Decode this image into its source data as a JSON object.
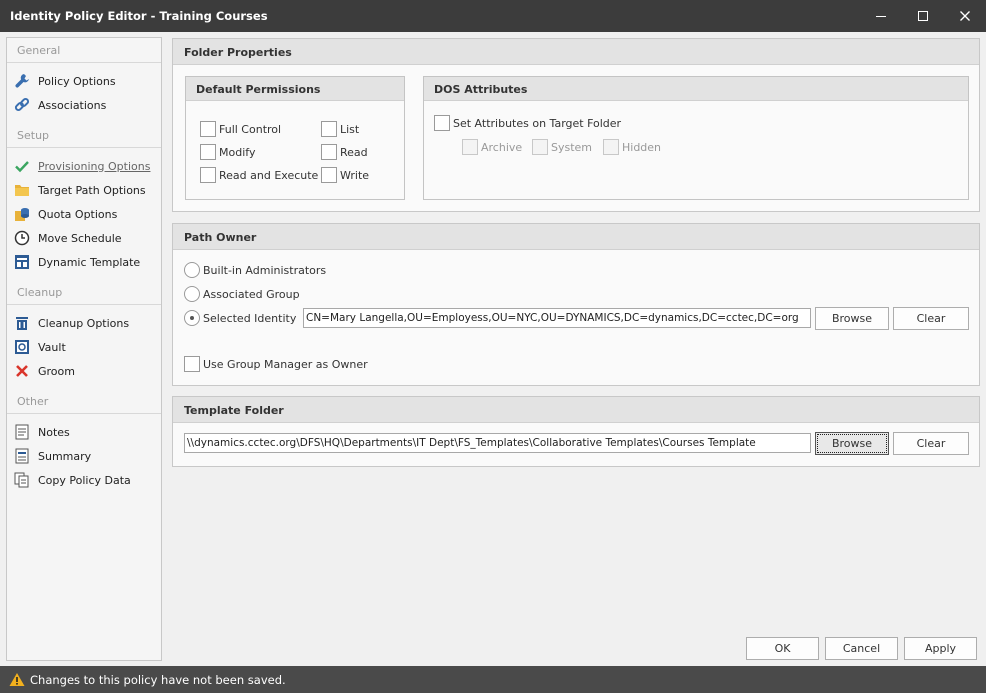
{
  "window": {
    "title": "Identity Policy Editor - Training Courses"
  },
  "sidebar": {
    "sections": [
      {
        "label": "General",
        "items": [
          {
            "label": "Policy Options",
            "icon": "wrench-icon"
          },
          {
            "label": "Associations",
            "icon": "link-icon"
          }
        ]
      },
      {
        "label": "Setup",
        "items": [
          {
            "label": "Provisioning Options",
            "icon": "checkmark-icon"
          },
          {
            "label": "Target Path Options",
            "icon": "folder-icon"
          },
          {
            "label": "Quota Options",
            "icon": "quota-icon"
          },
          {
            "label": "Move Schedule",
            "icon": "clock-icon"
          },
          {
            "label": "Dynamic Template",
            "icon": "template-icon"
          }
        ]
      },
      {
        "label": "Cleanup",
        "items": [
          {
            "label": "Cleanup Options",
            "icon": "trash-icon"
          },
          {
            "label": "Vault",
            "icon": "vault-icon"
          },
          {
            "label": "Groom",
            "icon": "x-icon"
          }
        ]
      },
      {
        "label": "Other",
        "items": [
          {
            "label": "Notes",
            "icon": "notes-icon"
          },
          {
            "label": "Summary",
            "icon": "summary-icon"
          },
          {
            "label": "Copy Policy Data",
            "icon": "copy-icon"
          }
        ]
      }
    ]
  },
  "folder_properties": {
    "title": "Folder Properties",
    "default_permissions": {
      "title": "Default Permissions",
      "full_control": "Full Control",
      "modify": "Modify",
      "read_and_execute": "Read and Execute",
      "list": "List",
      "read": "Read",
      "write": "Write"
    },
    "dos_attributes": {
      "title": "DOS Attributes",
      "set_attributes": "Set Attributes on Target Folder",
      "archive": "Archive",
      "system": "System",
      "hidden": "Hidden"
    }
  },
  "path_owner": {
    "title": "Path Owner",
    "builtin_admins": "Built-in Administrators",
    "associated_group": "Associated Group",
    "selected_identity": "Selected Identity",
    "identity_value": "CN=Mary Langella,OU=Employess,OU=NYC,OU=DYNAMICS,DC=dynamics,DC=cctec,DC=org",
    "browse": "Browse",
    "clear": "Clear",
    "use_group_manager": "Use Group Manager as Owner",
    "selected_option": "selected_identity"
  },
  "template_folder": {
    "title": "Template Folder",
    "path_value": "\\\\dynamics.cctec.org\\DFS\\HQ\\Departments\\IT Dept\\FS_Templates\\Collaborative Templates\\Courses Template",
    "browse": "Browse",
    "clear": "Clear"
  },
  "footer": {
    "ok": "OK",
    "cancel": "Cancel",
    "apply": "Apply"
  },
  "status": {
    "message": "Changes to this policy have not been saved.",
    "icon": "warning-icon"
  }
}
